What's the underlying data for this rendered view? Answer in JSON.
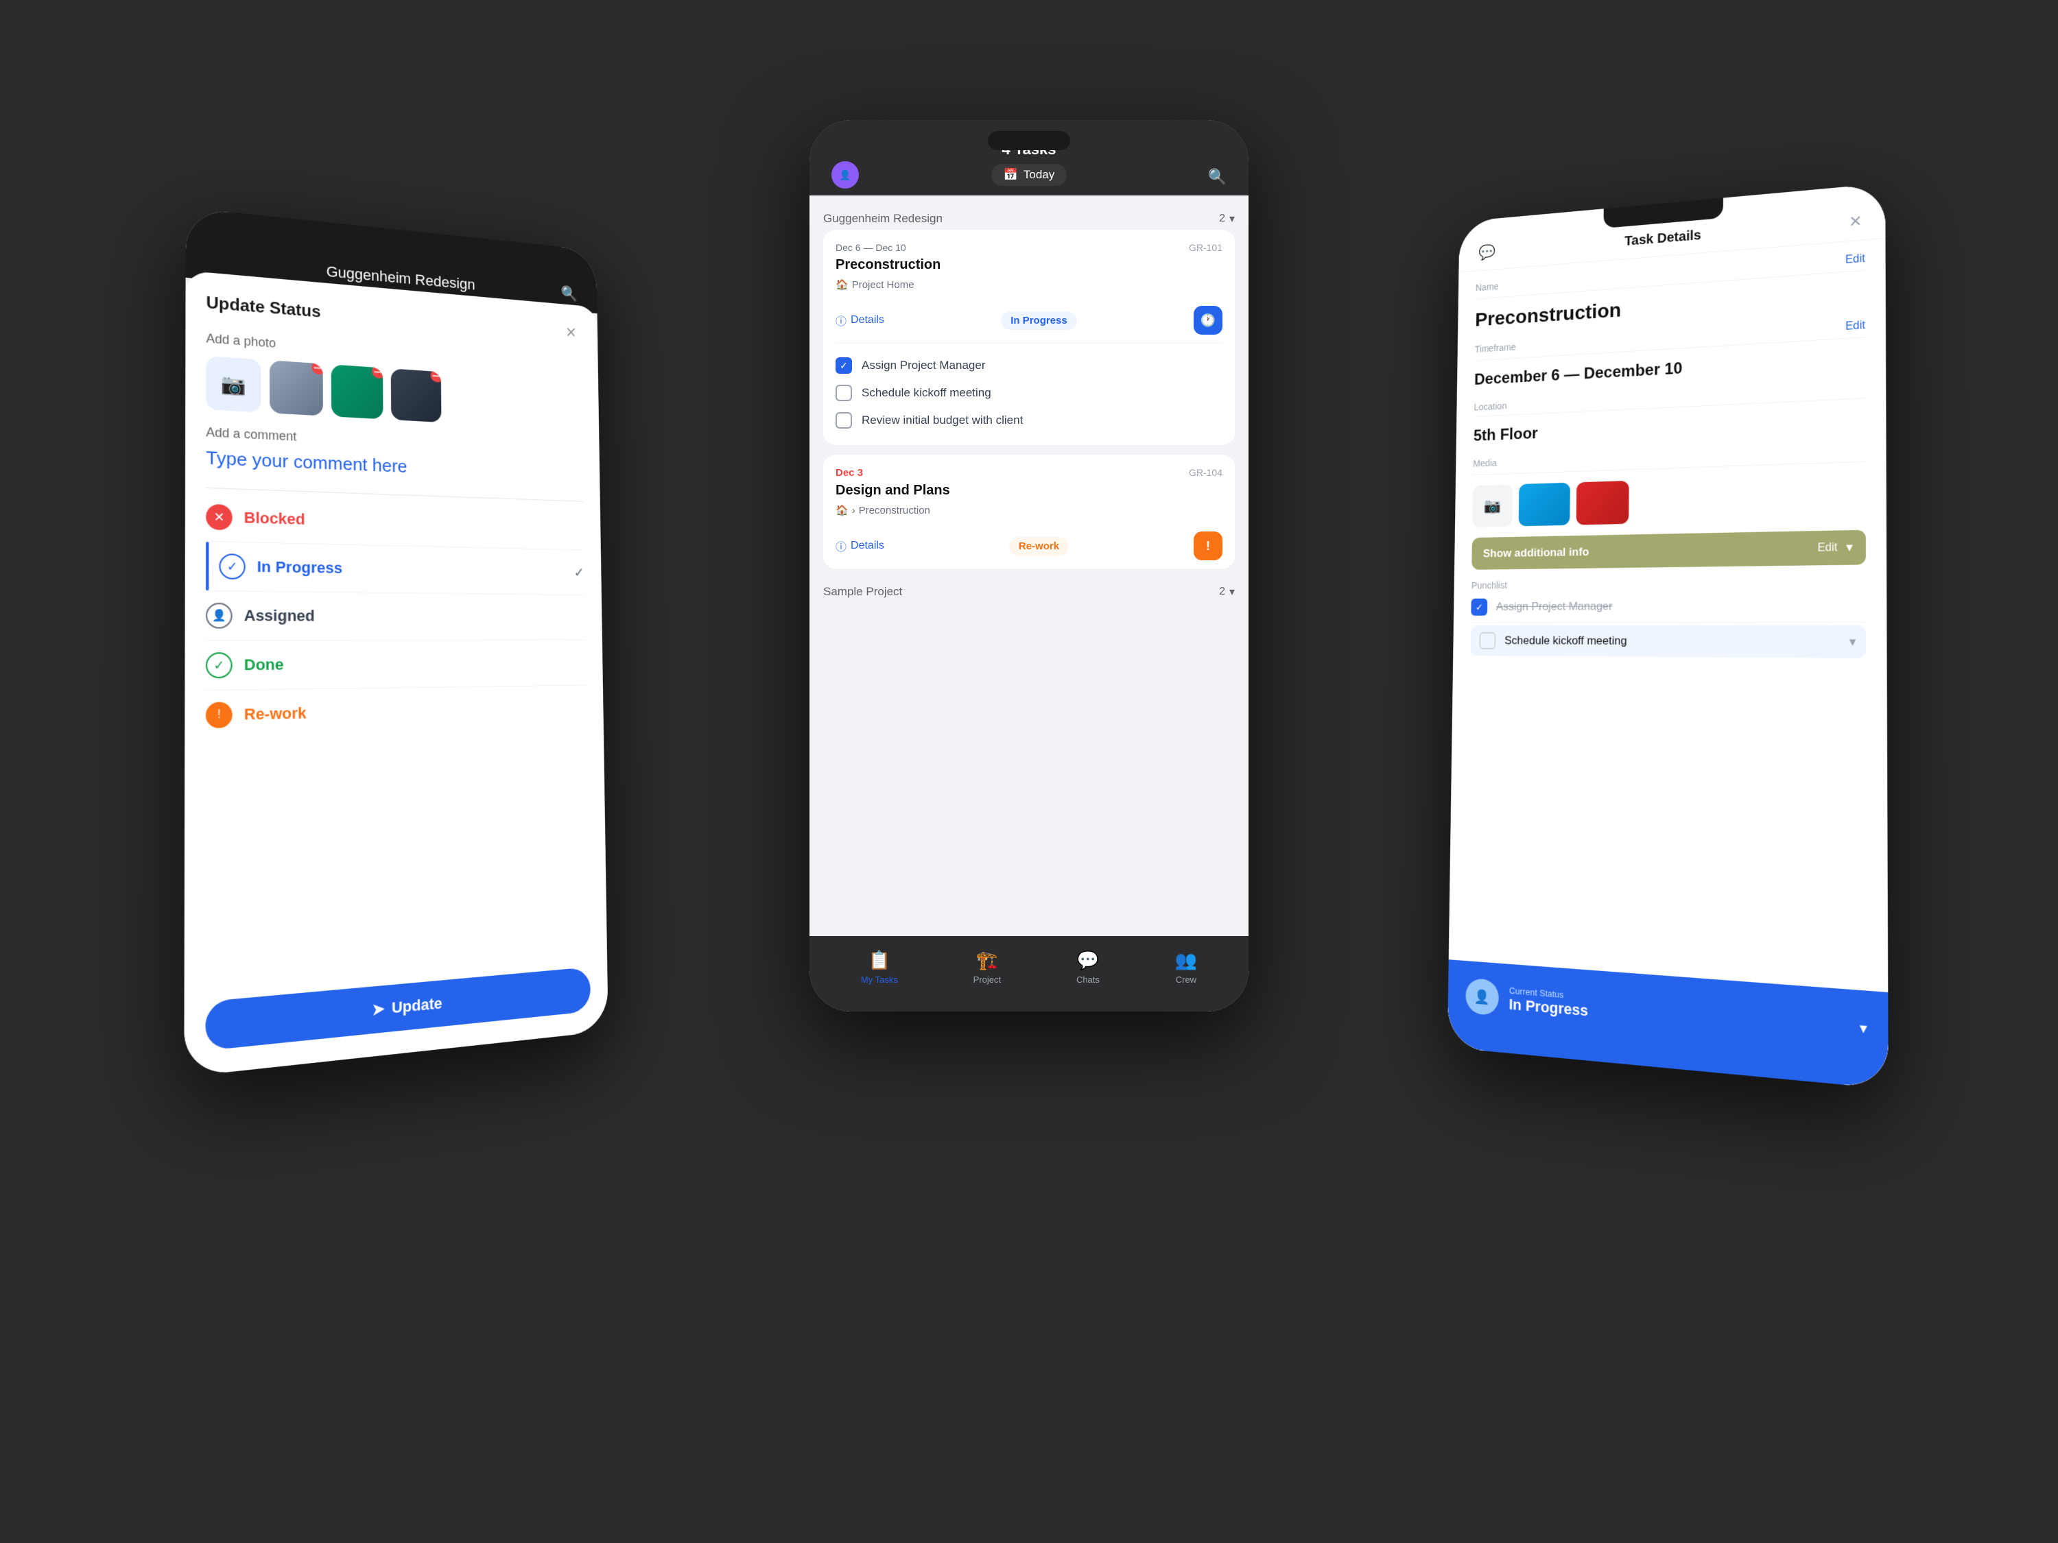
{
  "background": "#2a2a2a",
  "phones": {
    "left": {
      "header_title": "Guggenheim Redesign",
      "sheet": {
        "title": "Update Status",
        "add_photo_label": "Add a photo",
        "add_comment_label": "Add a comment",
        "comment_placeholder": "Type your comment here",
        "statuses": [
          {
            "key": "blocked",
            "label": "Blocked",
            "icon": "✕",
            "style": "blocked"
          },
          {
            "key": "in-progress",
            "label": "In Progress",
            "icon": "✓",
            "style": "in-progress",
            "selected": true
          },
          {
            "key": "assigned",
            "label": "Assigned",
            "icon": "👤",
            "style": "assigned"
          },
          {
            "key": "done",
            "label": "Done",
            "icon": "✓",
            "style": "done"
          },
          {
            "key": "rework",
            "label": "Re-work",
            "icon": "!",
            "style": "rework"
          }
        ],
        "update_button": "Update"
      }
    },
    "center": {
      "tasks_count": "4 Tasks",
      "date_label": "Today",
      "sections": [
        {
          "project_name": "Guggenheim Redesign",
          "count": 2,
          "tasks": [
            {
              "id": "GR-101",
              "date_range": "Dec 6 — Dec 10",
              "name": "Preconstruction",
              "location": "Project Home",
              "status": "In Progress",
              "status_style": "in-progress",
              "icon": "🕐",
              "icon_style": "blue",
              "details_label": "Details",
              "checklist": [
                {
                  "text": "Assign Project Manager",
                  "checked": true
                },
                {
                  "text": "Schedule kickoff meeting",
                  "checked": false
                },
                {
                  "text": "Review initial budget with client",
                  "checked": false
                }
              ]
            },
            {
              "id": "GR-104",
              "date_range": "Dec 3",
              "name": "Design and Plans",
              "location": "Preconstruction",
              "status": "Re-work",
              "status_style": "rework",
              "icon": "!",
              "icon_style": "orange",
              "details_label": "Details"
            }
          ]
        },
        {
          "project_name": "Sample Project",
          "count": 2,
          "tasks": []
        }
      ],
      "nav": [
        {
          "label": "My Tasks",
          "icon": "📋",
          "active": true
        },
        {
          "label": "Project",
          "icon": "🏗️",
          "active": false
        },
        {
          "label": "Chats",
          "icon": "💬",
          "active": false
        },
        {
          "label": "Crew",
          "icon": "👥",
          "active": false
        }
      ]
    },
    "right": {
      "screen_title": "Task Details",
      "edit_label": "Edit",
      "fields": {
        "name_label": "Name",
        "name_value": "Preconstruction",
        "timeframe_label": "Timeframe",
        "timeframe_value": "December 6 — December 10",
        "location_label": "Location",
        "location_value": "5th Floor",
        "media_label": "Media",
        "show_additional_info": "Show additional info",
        "punchlist_label": "Punchlist"
      },
      "punchlist": [
        {
          "text": "Assign Project Manager",
          "done": true,
          "strikethrough": true
        },
        {
          "text": "Schedule kickoff meeting",
          "done": false,
          "strikethrough": false
        }
      ],
      "current_status_label": "Current Status",
      "current_status_value": "In Progress"
    }
  }
}
